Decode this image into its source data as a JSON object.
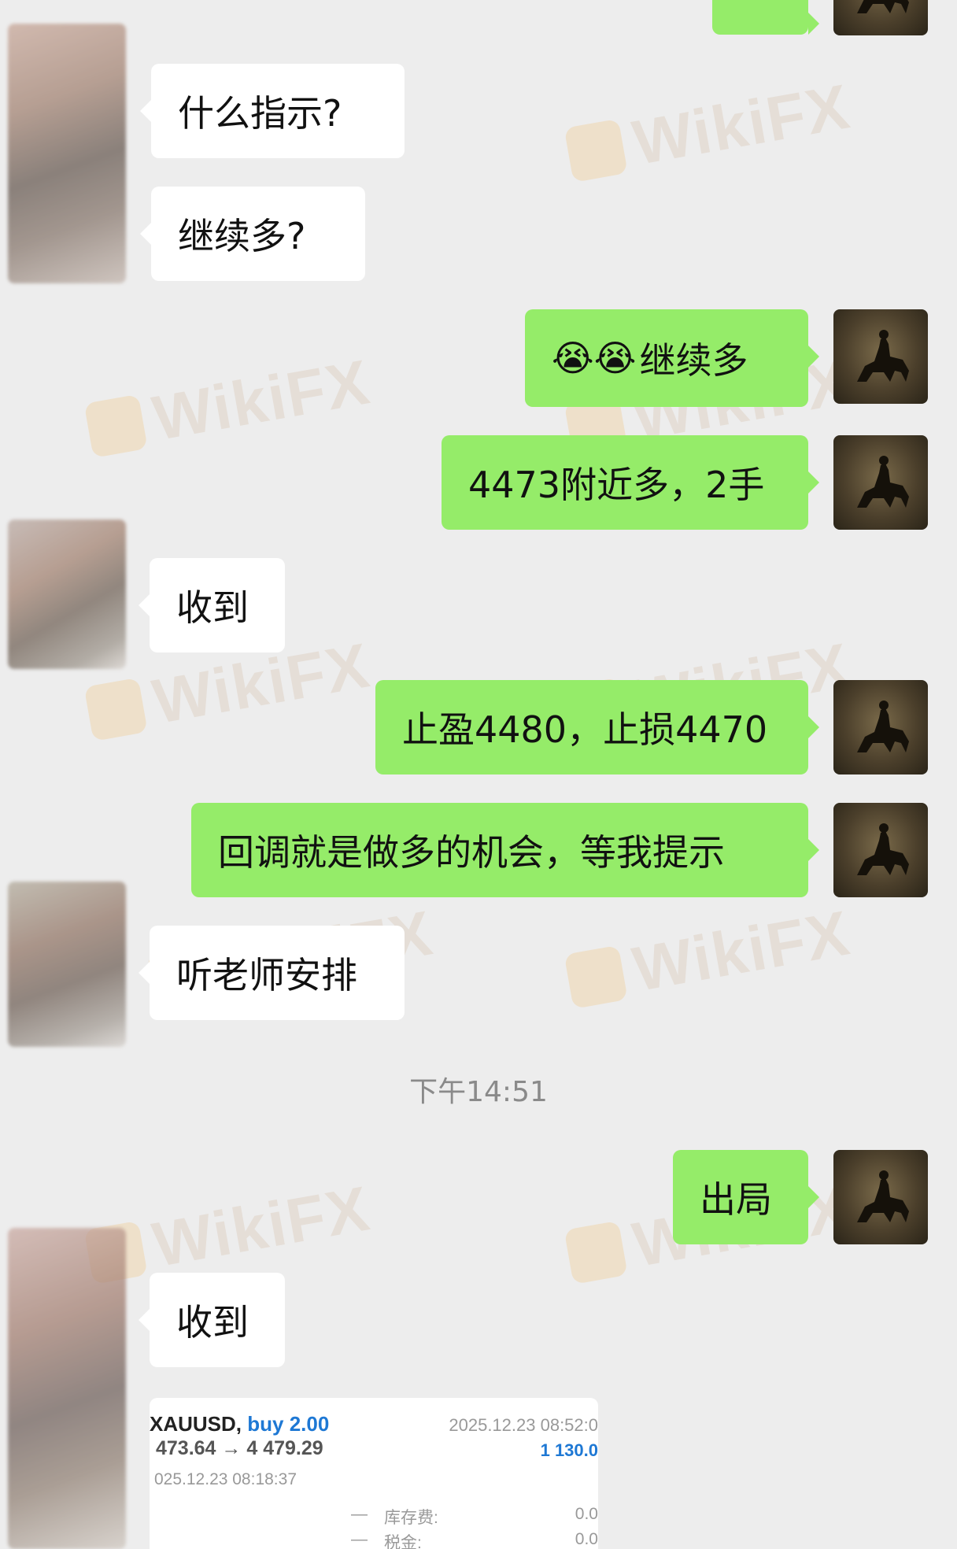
{
  "messages": {
    "m1": "什么指示?",
    "m2": "继续多?",
    "m3_emoji": "😭😭",
    "m3": "继续多",
    "m4": "4473附近多，2手",
    "m5": "收到",
    "m6": "止盈4480，止损4470",
    "m7": "回调就是做多的机会，等我提示",
    "m8": "听老师安排",
    "m9": "出局",
    "m10": "收到"
  },
  "timestamp": "下午14:51",
  "watermark": "WikiFX",
  "trade_card": {
    "symbol": "XAUUSD,",
    "side": "buy 2.00",
    "open_time": "2025.12.23 08:52:0",
    "prices": "473.64 → 4 479.29",
    "profit": "1 130.0",
    "close_time": "025.12.23 08:18:37",
    "swap_label": "库存费:",
    "swap_value": "0.0",
    "tax_label": "税金:",
    "tax_value": "0.0",
    "dash": "—"
  },
  "colors": {
    "background": "#ededed",
    "incoming_bubble": "#ffffff",
    "outgoing_bubble": "#95ec69",
    "trade_side": "#1e78d4"
  }
}
